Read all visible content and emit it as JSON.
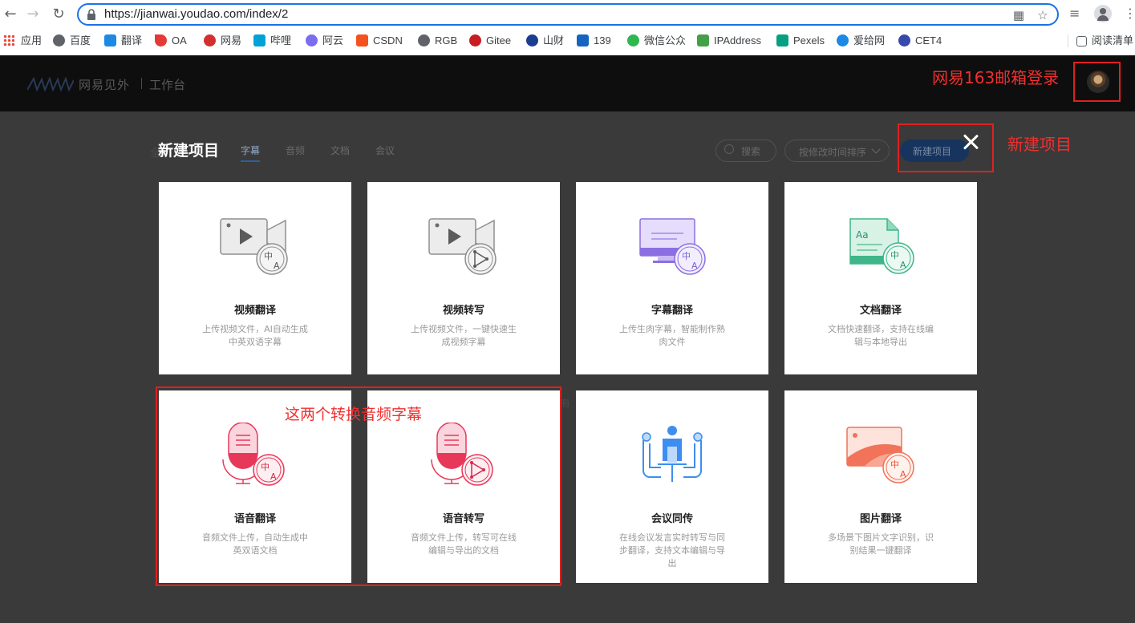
{
  "browser": {
    "url": "https://jianwai.youdao.com/index/2",
    "bookmarks": [
      "应用",
      "百度",
      "翻译",
      "OA",
      "网易",
      "哔哩",
      "阿云",
      "CSDN",
      "RGB",
      "Gitee",
      "山财",
      "139",
      "微信公众",
      "IPAddress",
      "Pexels",
      "爱给网",
      "CET4"
    ],
    "reading_list": "阅读清单"
  },
  "header": {
    "brand": "网易见外",
    "workbench": "工作台"
  },
  "annotations": {
    "login": "网易163邮箱登录",
    "new_project": "新建项目",
    "audio_note": "这两个转换音频字幕"
  },
  "modal": {
    "title": "新建项目",
    "tabs": [
      "字幕",
      "音频",
      "文档",
      "会议"
    ],
    "search_label": "搜索",
    "sort_label": "按修改时间排序",
    "new_button": "新建项目"
  },
  "cards": [
    {
      "title": "视频翻译",
      "desc": "上传视频文件，AI自动生成中英双语字幕",
      "icon": "video-translate-icon",
      "color": "#9a9a9a"
    },
    {
      "title": "视频转写",
      "desc": "上传视频文件，一键快速生成视频字幕",
      "icon": "video-transcribe-icon",
      "color": "#9a9a9a"
    },
    {
      "title": "字幕翻译",
      "desc": "上传生肉字幕，智能制作熟肉文件",
      "icon": "subtitle-translate-icon",
      "color": "#8b6fe0"
    },
    {
      "title": "文档翻译",
      "desc": "文档快速翻译，支持在线编辑与本地导出",
      "icon": "document-translate-icon",
      "color": "#3fb58a"
    },
    {
      "title": "语音翻译",
      "desc": "音频文件上传，自动生成中英双语文档",
      "icon": "audio-translate-icon",
      "color": "#e8385a"
    },
    {
      "title": "语音转写",
      "desc": "音频文件上传，转写可在线编辑与导出的文档",
      "icon": "audio-transcribe-icon",
      "color": "#e8385a"
    },
    {
      "title": "会议同传",
      "desc": "在线会议发言实时转写与同步翻译，支持文本编辑与导出",
      "icon": "meeting-interpret-icon",
      "color": "#3d8ef0"
    },
    {
      "title": "图片翻译",
      "desc": "多场景下图片文字识别，识别结果一键翻译",
      "icon": "image-translate-icon",
      "color": "#f0735a"
    }
  ],
  "icon_glyphs": {
    "zh": "中",
    "a": "A",
    "aa": "Aa"
  }
}
